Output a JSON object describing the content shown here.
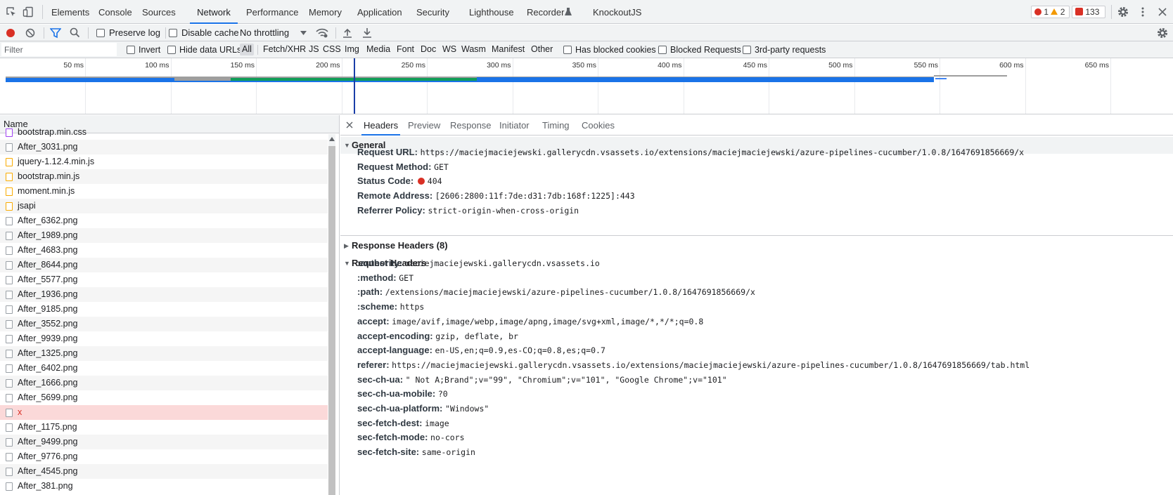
{
  "tabbar": {
    "tabs": [
      "Elements",
      "Console",
      "Sources",
      "Network",
      "Performance",
      "Memory",
      "Application",
      "Security",
      "Lighthouse",
      "Recorder",
      "KnockoutJS"
    ],
    "active": "Network",
    "errors": "1",
    "warnings": "2",
    "issues": "133"
  },
  "toolbar": {
    "preserve_log": "Preserve log",
    "disable_cache": "Disable cache",
    "throttling": "No throttling"
  },
  "filterbar": {
    "placeholder": "Filter",
    "invert": "Invert",
    "hide_data_urls": "Hide data URLs",
    "types": [
      "All",
      "Fetch/XHR",
      "JS",
      "CSS",
      "Img",
      "Media",
      "Font",
      "Doc",
      "WS",
      "Wasm",
      "Manifest",
      "Other"
    ],
    "has_blocked_cookies": "Has blocked cookies",
    "blocked_requests": "Blocked Requests",
    "third_party": "3rd-party requests"
  },
  "timeline": {
    "ticks": [
      "50 ms",
      "100 ms",
      "150 ms",
      "200 ms",
      "250 ms",
      "300 ms",
      "350 ms",
      "400 ms",
      "450 ms",
      "500 ms",
      "550 ms",
      "600 ms",
      "650 ms"
    ]
  },
  "reqlist": {
    "header": "Name",
    "items": [
      {
        "name": "bootstrap.min.css",
        "type": "css"
      },
      {
        "name": "After_3031.png",
        "type": "img"
      },
      {
        "name": "jquery-1.12.4.min.js",
        "type": "js"
      },
      {
        "name": "bootstrap.min.js",
        "type": "js"
      },
      {
        "name": "moment.min.js",
        "type": "js"
      },
      {
        "name": "jsapi",
        "type": "js"
      },
      {
        "name": "After_6362.png",
        "type": "img"
      },
      {
        "name": "After_1989.png",
        "type": "img"
      },
      {
        "name": "After_4683.png",
        "type": "img"
      },
      {
        "name": "After_8644.png",
        "type": "img"
      },
      {
        "name": "After_5577.png",
        "type": "img"
      },
      {
        "name": "After_1936.png",
        "type": "img"
      },
      {
        "name": "After_9185.png",
        "type": "img"
      },
      {
        "name": "After_3552.png",
        "type": "img"
      },
      {
        "name": "After_9939.png",
        "type": "img"
      },
      {
        "name": "After_1325.png",
        "type": "img"
      },
      {
        "name": "After_6402.png",
        "type": "img"
      },
      {
        "name": "After_1666.png",
        "type": "img"
      },
      {
        "name": "After_5699.png",
        "type": "img"
      },
      {
        "name": "x",
        "type": "err"
      },
      {
        "name": "After_1175.png",
        "type": "img"
      },
      {
        "name": "After_9499.png",
        "type": "img"
      },
      {
        "name": "After_9776.png",
        "type": "img"
      },
      {
        "name": "After_4545.png",
        "type": "img"
      },
      {
        "name": "After_381.png",
        "type": "img"
      }
    ]
  },
  "detail": {
    "tabs": [
      "Headers",
      "Preview",
      "Response",
      "Initiator",
      "Timing",
      "Cookies"
    ],
    "active": "Headers",
    "general": {
      "title": "General",
      "rows": [
        {
          "k": "Request URL:",
          "v": "https://maciejmaciejewski.gallerycdn.vsassets.io/extensions/maciejmaciejewski/azure-pipelines-cucumber/1.0.8/1647691856669/x"
        },
        {
          "k": "Request Method:",
          "v": "GET"
        },
        {
          "k": "Status Code:",
          "v": "404"
        },
        {
          "k": "Remote Address:",
          "v": "[2606:2800:11f:7de:d31:7db:168f:1225]:443"
        },
        {
          "k": "Referrer Policy:",
          "v": "strict-origin-when-cross-origin"
        }
      ]
    },
    "response_headers": {
      "title": "Response Headers (8)"
    },
    "request_headers": {
      "title": "Request Headers",
      "rows": [
        {
          "k": ":authority:",
          "v": "maciejmaciejewski.gallerycdn.vsassets.io"
        },
        {
          "k": ":method:",
          "v": "GET"
        },
        {
          "k": ":path:",
          "v": "/extensions/maciejmaciejewski/azure-pipelines-cucumber/1.0.8/1647691856669/x"
        },
        {
          "k": ":scheme:",
          "v": "https"
        },
        {
          "k": "accept:",
          "v": "image/avif,image/webp,image/apng,image/svg+xml,image/*,*/*;q=0.8"
        },
        {
          "k": "accept-encoding:",
          "v": "gzip, deflate, br"
        },
        {
          "k": "accept-language:",
          "v": "en-US,en;q=0.9,es-CO;q=0.8,es;q=0.7"
        },
        {
          "k": "referer:",
          "v": "https://maciejmaciejewski.gallerycdn.vsassets.io/extensions/maciejmaciejewski/azure-pipelines-cucumber/1.0.8/1647691856669/tab.html"
        },
        {
          "k": "sec-ch-ua:",
          "v": "\" Not A;Brand\";v=\"99\", \"Chromium\";v=\"101\", \"Google Chrome\";v=\"101\""
        },
        {
          "k": "sec-ch-ua-mobile:",
          "v": "?0"
        },
        {
          "k": "sec-ch-ua-platform:",
          "v": "\"Windows\""
        },
        {
          "k": "sec-fetch-dest:",
          "v": "image"
        },
        {
          "k": "sec-fetch-mode:",
          "v": "no-cors"
        },
        {
          "k": "sec-fetch-site:",
          "v": "same-origin"
        }
      ]
    }
  },
  "colors": {
    "accent": "#1a73e8",
    "error": "#d93025",
    "warning": "#f29900"
  }
}
